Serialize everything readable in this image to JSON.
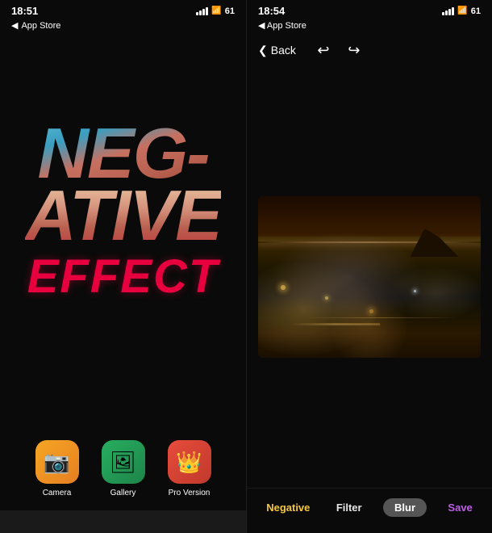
{
  "left_screen": {
    "status_bar": {
      "time": "18:51",
      "signal_indicator": "◀",
      "wifi": "wifi",
      "battery": "61"
    },
    "app_store_back": "◀ App Store",
    "title_lines": {
      "line1": "NEG-",
      "line2": "ATIVE",
      "line3": "EFFECT"
    },
    "buttons": [
      {
        "id": "camera",
        "label": "Camera",
        "icon": "📷",
        "bg": "camera"
      },
      {
        "id": "gallery",
        "label": "Gallery",
        "icon": "🖼",
        "bg": "gallery"
      },
      {
        "id": "pro",
        "label": "Pro Version",
        "icon": "👑",
        "bg": "pro"
      }
    ]
  },
  "right_screen": {
    "status_bar": {
      "time": "18:54",
      "battery": "61"
    },
    "app_store_back": "◀ App Store",
    "nav": {
      "back_label": "Back",
      "undo_icon": "↩",
      "redo_icon": "↪"
    },
    "toolbar": {
      "negative_label": "Negative",
      "filter_label": "Filter",
      "blur_label": "Blur",
      "save_label": "Save"
    }
  },
  "colors": {
    "accent_yellow": "#f5c842",
    "accent_purple": "#bf5fe8",
    "accent_red": "#e8003e"
  }
}
